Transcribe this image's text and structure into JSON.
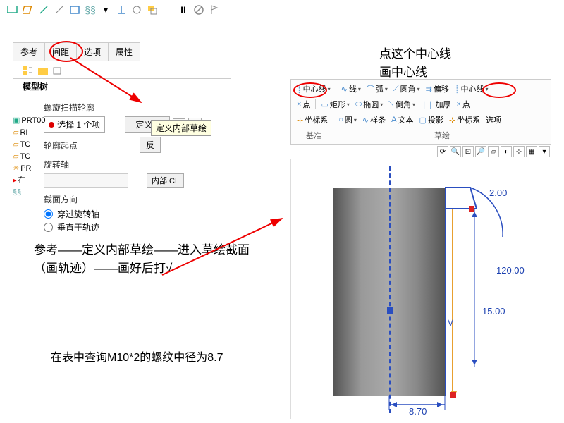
{
  "tabs": {
    "ref": "参考",
    "spacing": "间距",
    "options": "选项",
    "props": "属性"
  },
  "tree_label": "模型树",
  "tree_items": [
    "PRT00",
    "RI",
    "TC",
    "TC",
    "PR",
    "在",
    ""
  ],
  "panel": {
    "section1": "螺旋扫描轮廓",
    "select_text": "选择 1 个项",
    "define": "定义...",
    "section2": "轮廓起点",
    "flip": "反",
    "tooltip": "定义内部草绘",
    "section3": "旋转轴",
    "inner_cl": "内部 CL",
    "section4": "截面方向",
    "radio1": "穿过旋转轴",
    "radio2": "垂直于轨迹"
  },
  "annotations": {
    "top_right_1": "点这个中心线",
    "top_right_2": "画中心线",
    "mid": "参考——定义内部草绘——进入草绘截面（画轨迹）——画好后打√",
    "bottom": "在表中查询M10*2的螺纹中径为8.7"
  },
  "ribbon": {
    "centerline": "中心线",
    "point": "点",
    "coord": "坐标系",
    "line": "线",
    "arc": "弧",
    "rect": "矩形",
    "circle": "圆",
    "spline": "样条",
    "ellipse": "椭圆",
    "fillet": "圆角",
    "chamfer": "倒角",
    "text": "文本",
    "offset": "偏移",
    "thicken": "加厚",
    "proj": "投影",
    "centerline2": "中心线",
    "point2": "点",
    "coord2": "坐标系",
    "options": "选项",
    "group1": "基准",
    "group2": "草绘"
  },
  "dims": {
    "d1": "2.00",
    "d2": "120.00",
    "d3": "15.00",
    "d4": "8.70"
  }
}
